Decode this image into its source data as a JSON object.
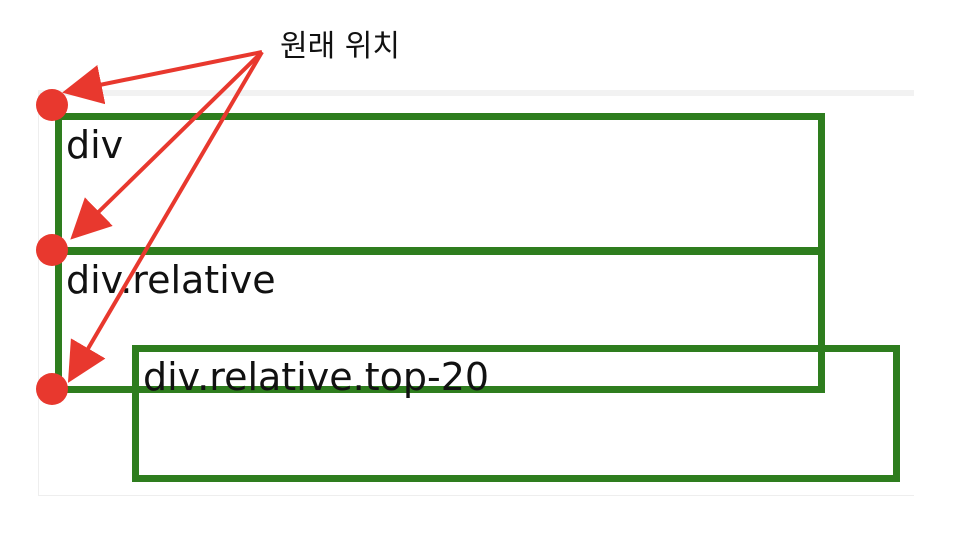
{
  "annotation": {
    "text": "원래 위치"
  },
  "boxes": {
    "div": {
      "label": "div"
    },
    "relative": {
      "label": "div.relative"
    },
    "relative_top20": {
      "label": "div.relative.top-20"
    }
  },
  "colors": {
    "box_border": "#2e7d1e",
    "marker": "#e8382e",
    "arrow": "#e8382e",
    "text": "#111111"
  }
}
